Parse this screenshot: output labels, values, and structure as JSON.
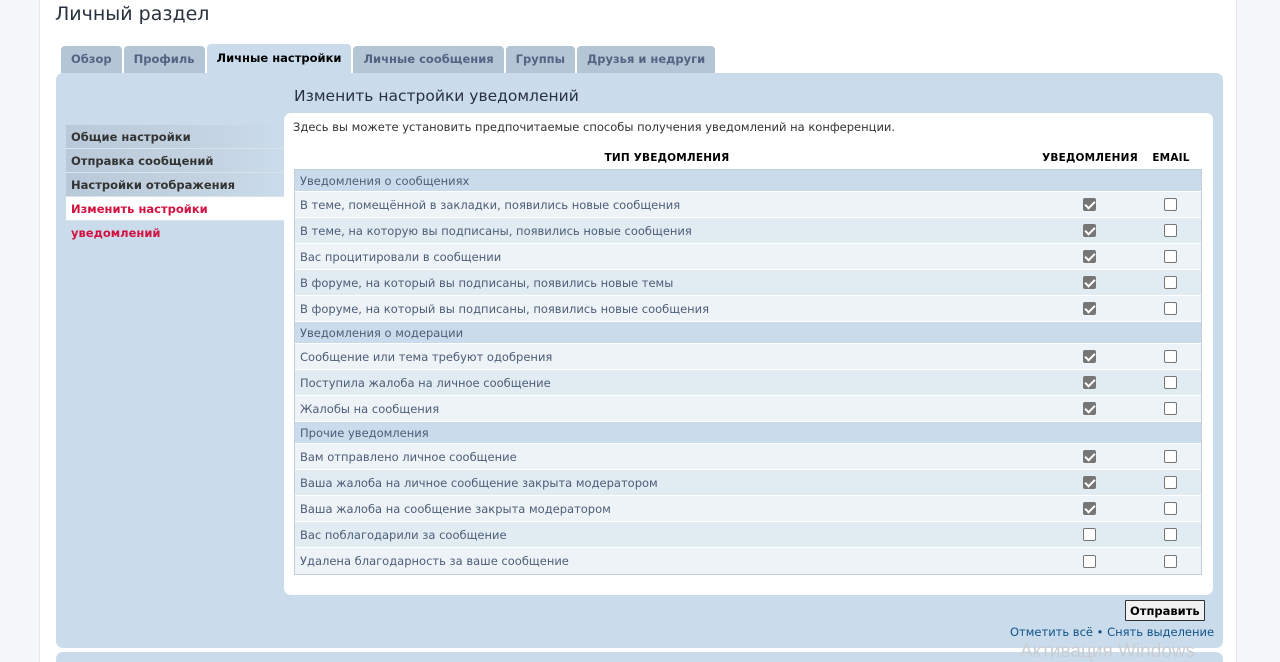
{
  "page": {
    "title": "Личный раздел"
  },
  "tabs": [
    {
      "label": "Обзор"
    },
    {
      "label": "Профиль"
    },
    {
      "label": "Личные настройки"
    },
    {
      "label": "Личные сообщения"
    },
    {
      "label": "Группы"
    },
    {
      "label": "Друзья и недруги"
    }
  ],
  "sidebar": {
    "items": [
      {
        "label": "Общие настройки"
      },
      {
        "label": "Отправка сообщений"
      },
      {
        "label": "Настройки отображения"
      },
      {
        "label": "Изменить настройки уведомлений"
      }
    ]
  },
  "content": {
    "title": "Изменить настройки уведомлений",
    "intro": "Здесь вы можете установить предпочитаемые способы получения уведомлений на конференции.",
    "columns": {
      "type": "ТИП УВЕДОМЛЕНИЯ",
      "notifications": "УВЕДОМЛЕНИЯ",
      "email": "EMAIL"
    },
    "sections": [
      {
        "title": "Уведомления о сообщениях",
        "rows": [
          {
            "label": "В теме, помещённой в закладки, появились новые сообщения",
            "notify": true,
            "email": false
          },
          {
            "label": "В теме, на которую вы подписаны, появились новые сообщения",
            "notify": true,
            "email": false
          },
          {
            "label": "Вас процитировали в сообщении",
            "notify": true,
            "email": false
          },
          {
            "label": "В форуме, на который вы подписаны, появились новые темы",
            "notify": true,
            "email": false
          },
          {
            "label": "В форуме, на который вы подписаны, появились новые сообщения",
            "notify": true,
            "email": false
          }
        ]
      },
      {
        "title": "Уведомления о модерации",
        "rows": [
          {
            "label": "Сообщение или тема требуют одобрения",
            "notify": true,
            "email": false
          },
          {
            "label": "Поступила жалоба на личное сообщение",
            "notify": true,
            "email": false
          },
          {
            "label": "Жалобы на сообщения",
            "notify": true,
            "email": false
          }
        ]
      },
      {
        "title": "Прочие уведомления",
        "rows": [
          {
            "label": "Вам отправлено личное сообщение",
            "notify": true,
            "email": false
          },
          {
            "label": "Ваша жалоба на личное сообщение закрыта модератором",
            "notify": true,
            "email": false
          },
          {
            "label": "Ваша жалоба на сообщение закрыта модератором",
            "notify": true,
            "email": false
          },
          {
            "label": "Вас поблагодарили за сообщение",
            "notify": false,
            "email": false
          },
          {
            "label": "Удалена благодарность за ваше сообщение",
            "notify": false,
            "email": false
          }
        ]
      }
    ],
    "submit_label": "Отправить",
    "mark_all": "Отметить всё",
    "separator": " • ",
    "unmark_all": "Снять выделение"
  },
  "watermark": "Активация Windows"
}
